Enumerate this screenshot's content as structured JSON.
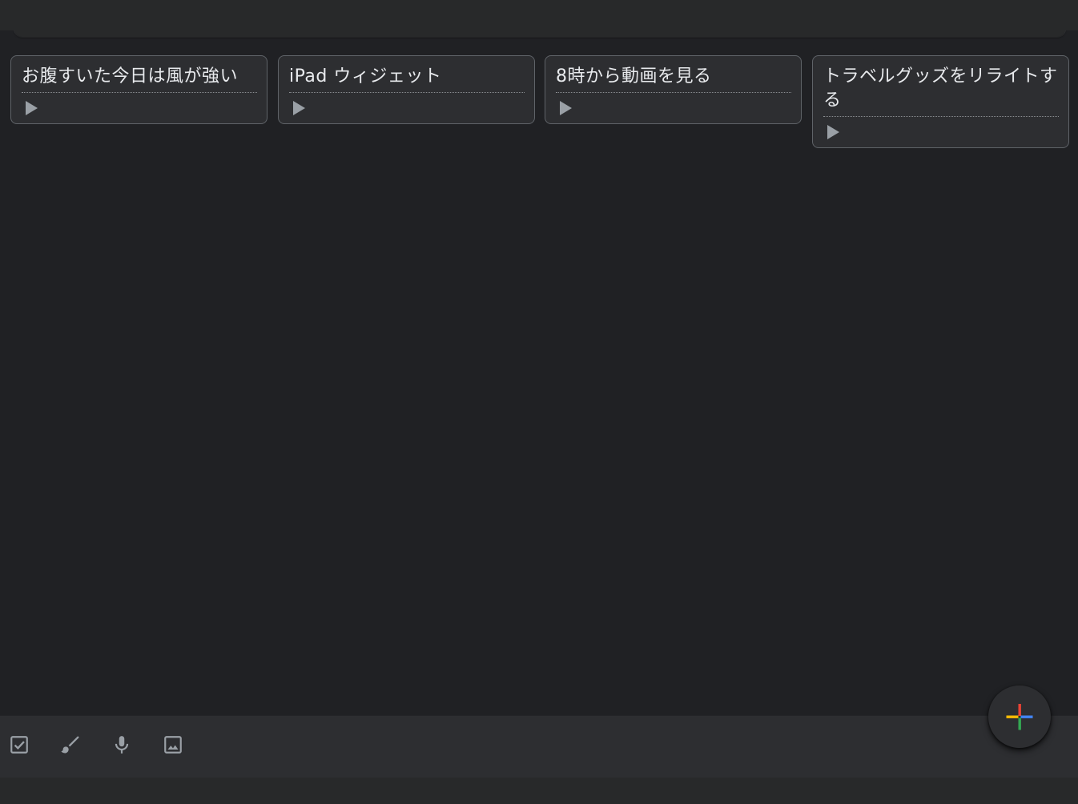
{
  "notes": [
    {
      "title": "お腹すいた今日は風が強い"
    },
    {
      "title": "iPad ウィジェット"
    },
    {
      "title": "8時から動画を見る"
    },
    {
      "title": "トラベルグッズをリライトする"
    }
  ],
  "toolbar": {
    "icons": [
      "checkbox-icon",
      "brush-icon",
      "microphone-icon",
      "image-icon"
    ]
  },
  "fab": {
    "icon": "multicolor-plus-icon"
  },
  "colors": {
    "background": "#202124",
    "card": "#2d2e31",
    "card_border": "#5f6368",
    "icon_gray": "#9aa0a6",
    "plus_red": "#ea4335",
    "plus_blue": "#4285f4",
    "plus_yellow": "#fbbc04",
    "plus_green": "#34a853"
  }
}
